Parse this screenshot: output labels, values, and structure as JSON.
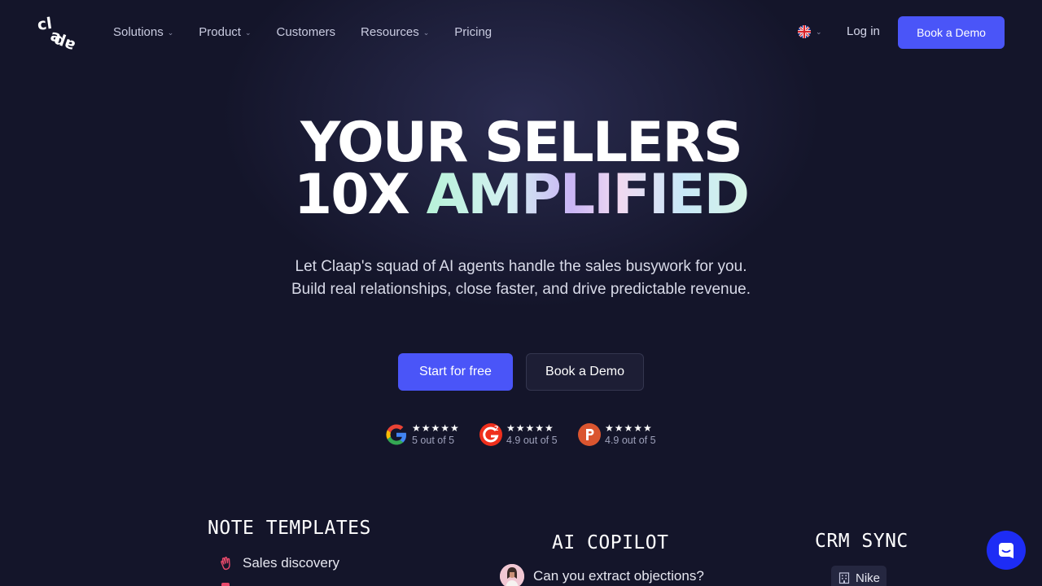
{
  "nav": {
    "logo_text": "claap",
    "items": [
      {
        "label": "Solutions",
        "has_dropdown": true
      },
      {
        "label": "Product",
        "has_dropdown": true
      },
      {
        "label": "Customers",
        "has_dropdown": false
      },
      {
        "label": "Resources",
        "has_dropdown": true
      },
      {
        "label": "Pricing",
        "has_dropdown": false
      }
    ],
    "language_icon": "uk-flag-icon",
    "login_label": "Log in",
    "demo_label": "Book a Demo"
  },
  "hero": {
    "headline_line1": "YOUR SELLERS",
    "headline_prefix": "10X",
    "headline_highlight": "AMPLIFIED",
    "subtitle_line1": "Let Claap's squad of AI agents handle the sales busywork for you.",
    "subtitle_line2": "Build real relationships, close faster, and drive predictable revenue.",
    "primary_cta": "Start for free",
    "secondary_cta": "Book a Demo"
  },
  "ratings": [
    {
      "source_icon": "google-icon",
      "stars": "★★★★★",
      "score": "5 out of 5"
    },
    {
      "source_icon": "g2-icon",
      "stars": "★★★★★",
      "score": "4.9 out of 5"
    },
    {
      "source_icon": "producthunt-icon",
      "stars": "★★★★★",
      "score": "4.9 out of 5"
    }
  ],
  "features": {
    "note_templates": {
      "title": "NOTE TEMPLATES",
      "item": "Sales discovery"
    },
    "ai_copilot": {
      "title": "AI COPILOT",
      "message": "Can you extract objections?"
    },
    "crm_sync": {
      "title": "CRM SYNC",
      "tag": "Nike"
    }
  },
  "colors": {
    "accent": "#4a55f8",
    "background": "#14152a",
    "chat": "#1d2cf5"
  }
}
